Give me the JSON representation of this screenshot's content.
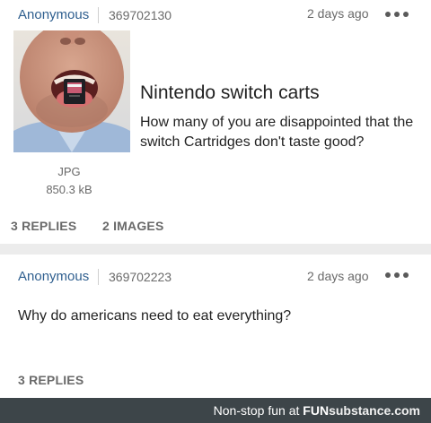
{
  "posts": [
    {
      "author": "Anonymous",
      "post_id": "369702130",
      "time": "2 days ago",
      "subject": "Nintendo switch carts",
      "body": "How many of you are disappointed that the switch Cartridges don't taste good?",
      "file": {
        "type": "JPG",
        "size": "850.3 kB"
      },
      "replies": "3 REPLIES",
      "images": "2 IMAGES"
    },
    {
      "author": "Anonymous",
      "post_id": "369702223",
      "time": "2 days ago",
      "body": "Why do americans need to eat everything?",
      "replies": "3 REPLIES"
    }
  ],
  "footer": {
    "tagline": "Non-stop fun at",
    "brand_bold": "FUN",
    "brand_rest": "substance.com"
  },
  "colors": {
    "author": "#2f5f8f",
    "meta": "#6a6a6a",
    "footer_bg": "#3d4549",
    "divider": "#ececec"
  },
  "icons": [
    "more-options-icon"
  ]
}
